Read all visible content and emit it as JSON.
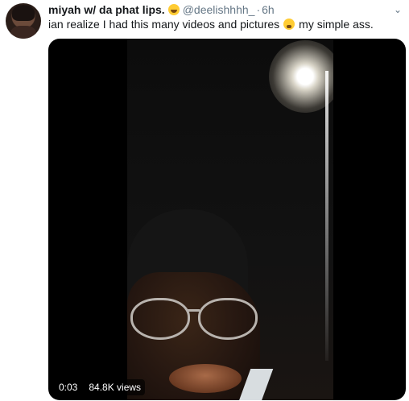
{
  "tweet": {
    "display_name": "miyah w/ da phat lips.",
    "name_emoji": "rolling-on-floor-laughing-emoji",
    "handle": "@deelishhhh_",
    "separator": "·",
    "time": "6h",
    "text_before_emoji": "ian realize I had this many videos and pictures",
    "text_emoji": "loudly-crying-face-emoji",
    "text_after_emoji": "my simple ass.",
    "menu_icon": "chevron-down-icon"
  },
  "video": {
    "elapsed": "0:03",
    "views": "84.8K views"
  }
}
